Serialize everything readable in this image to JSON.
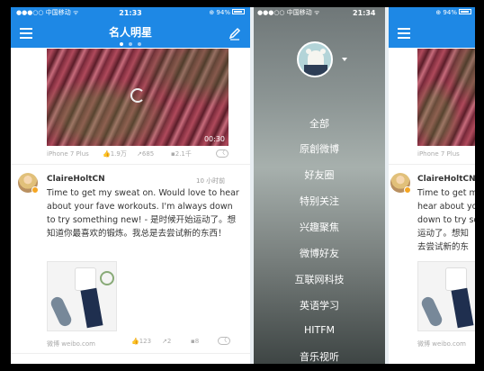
{
  "status_left": {
    "carrier": "●●●○○ 中国移动 ᯤ",
    "time": "21:33",
    "battery": "⊕ 94%"
  },
  "status_mid": {
    "carrier": "●●●○○ 中国移动 ᯤ",
    "time": "21:34",
    "battery": "⊕ 94%"
  },
  "status_right": {
    "battery": "⊕ 94%"
  },
  "nav": {
    "title": "名人明星"
  },
  "video": {
    "duration": "00:30"
  },
  "post1_meta": {
    "device": "iPhone 7 Plus",
    "likes": "1.9万",
    "reposts": "685",
    "comments": "2.1千"
  },
  "post2": {
    "user": "ClaireHoltCN",
    "time": "10 小时前",
    "text_en": "Time to get my sweat on. Would love to hear about your fave workouts. I'm always down to try something new! -",
    "text_cn": "是时候开始运动了。想知道你最喜欢的锻炼。我总是去尝试新的东西！",
    "source": "微博 weibo.com",
    "likes": "123",
    "reposts": "2",
    "comments": "8"
  },
  "menu_items": [
    "全部",
    "原創微博",
    "好友圈",
    "特别关注",
    "兴趣聚焦",
    "微博好友",
    "互联网科技",
    "英语学习",
    "HITFM",
    "音乐视听"
  ],
  "right_panel": {
    "device": "iPhone 7 Plus",
    "user": "ClaireHoltCN",
    "lines": [
      "Time to get my",
      "hear about your",
      "down to try so",
      "运动了。想知",
      "去尝试新的东"
    ],
    "source": "微博 weibo.com"
  },
  "colors": {
    "accent": "#1e88e5",
    "badge": "#f5a623"
  }
}
